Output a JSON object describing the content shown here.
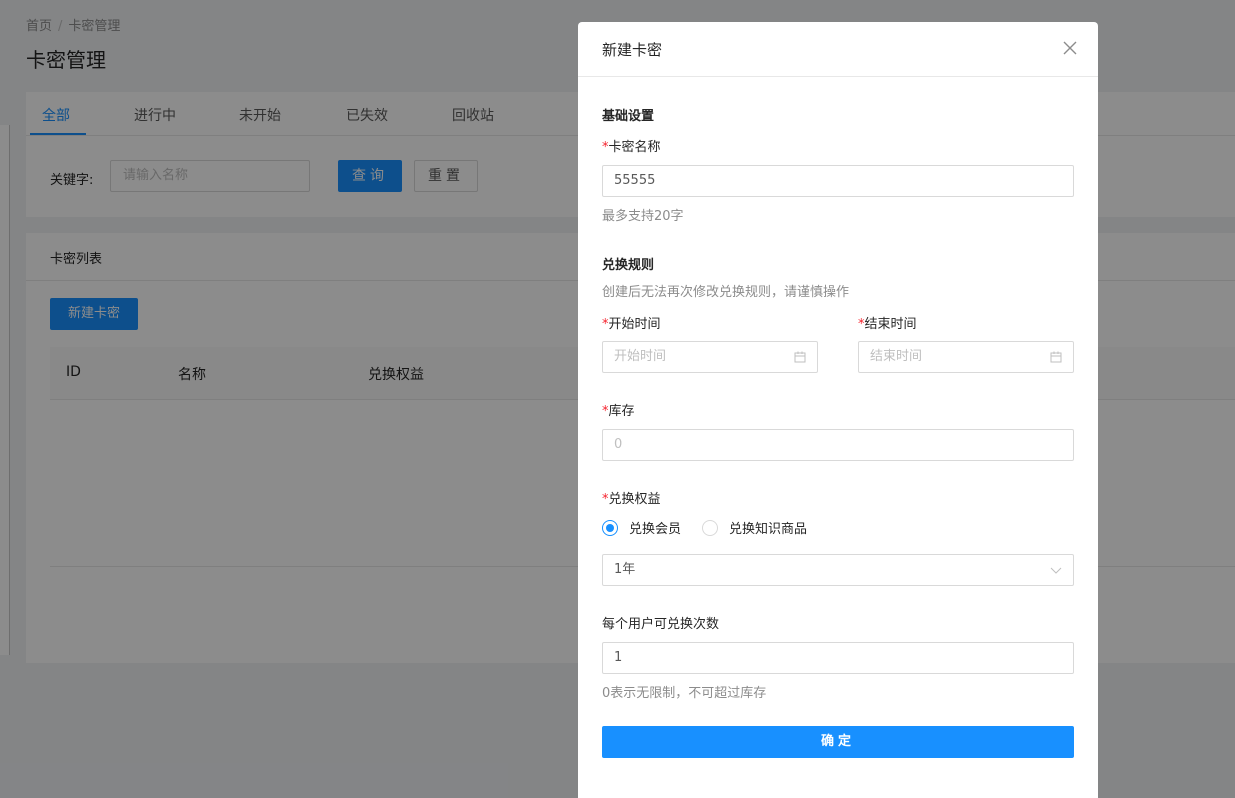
{
  "page": {
    "breadcrumb": [
      "首页",
      "卡密管理"
    ],
    "breadcrumb_sep": "/",
    "title": "卡密管理",
    "tabs": [
      {
        "label": "全部",
        "active": true
      },
      {
        "label": "进行中",
        "active": false
      },
      {
        "label": "未开始",
        "active": false
      },
      {
        "label": "已失效",
        "active": false
      },
      {
        "label": "回收站",
        "active": false
      }
    ],
    "filter": {
      "keyword_label": "关键字:",
      "keyword_placeholder": "请输入名称",
      "query_button": "查询",
      "reset_button": "重置"
    },
    "list": {
      "title": "卡密列表",
      "new_button": "新建卡密",
      "columns": [
        "ID",
        "名称",
        "兑换权益"
      ]
    }
  },
  "modal": {
    "title": "新建卡密",
    "close_icon": "close-icon",
    "basic": {
      "section_title": "基础设置",
      "required_mark": "*",
      "name_label": "卡密名称",
      "name_value": "55555",
      "name_hint": "最多支持20字"
    },
    "rules": {
      "section_title": "兑换规则",
      "section_hint": "创建后无法再次修改兑换规则，请谨慎操作",
      "start_label": "开始时间",
      "start_placeholder": "开始时间",
      "end_label": "结束时间",
      "end_placeholder": "结束时间",
      "calendar_icon": "calendar-icon",
      "stock_label": "库存",
      "stock_placeholder": "0",
      "benefit_label": "兑换权益",
      "benefit_options": [
        {
          "label": "兑换会员",
          "checked": true
        },
        {
          "label": "兑换知识商品",
          "checked": false
        }
      ],
      "membership_value": "1年",
      "per_user_label": "每个用户可兑换次数",
      "per_user_value": "1",
      "per_user_hint": "0表示无限制，不可超过库存"
    },
    "ok_button": "确定"
  },
  "colors": {
    "primary": "#1890ff",
    "required": "#f5222d",
    "mask": "rgba(0,0,0,0.45)"
  }
}
